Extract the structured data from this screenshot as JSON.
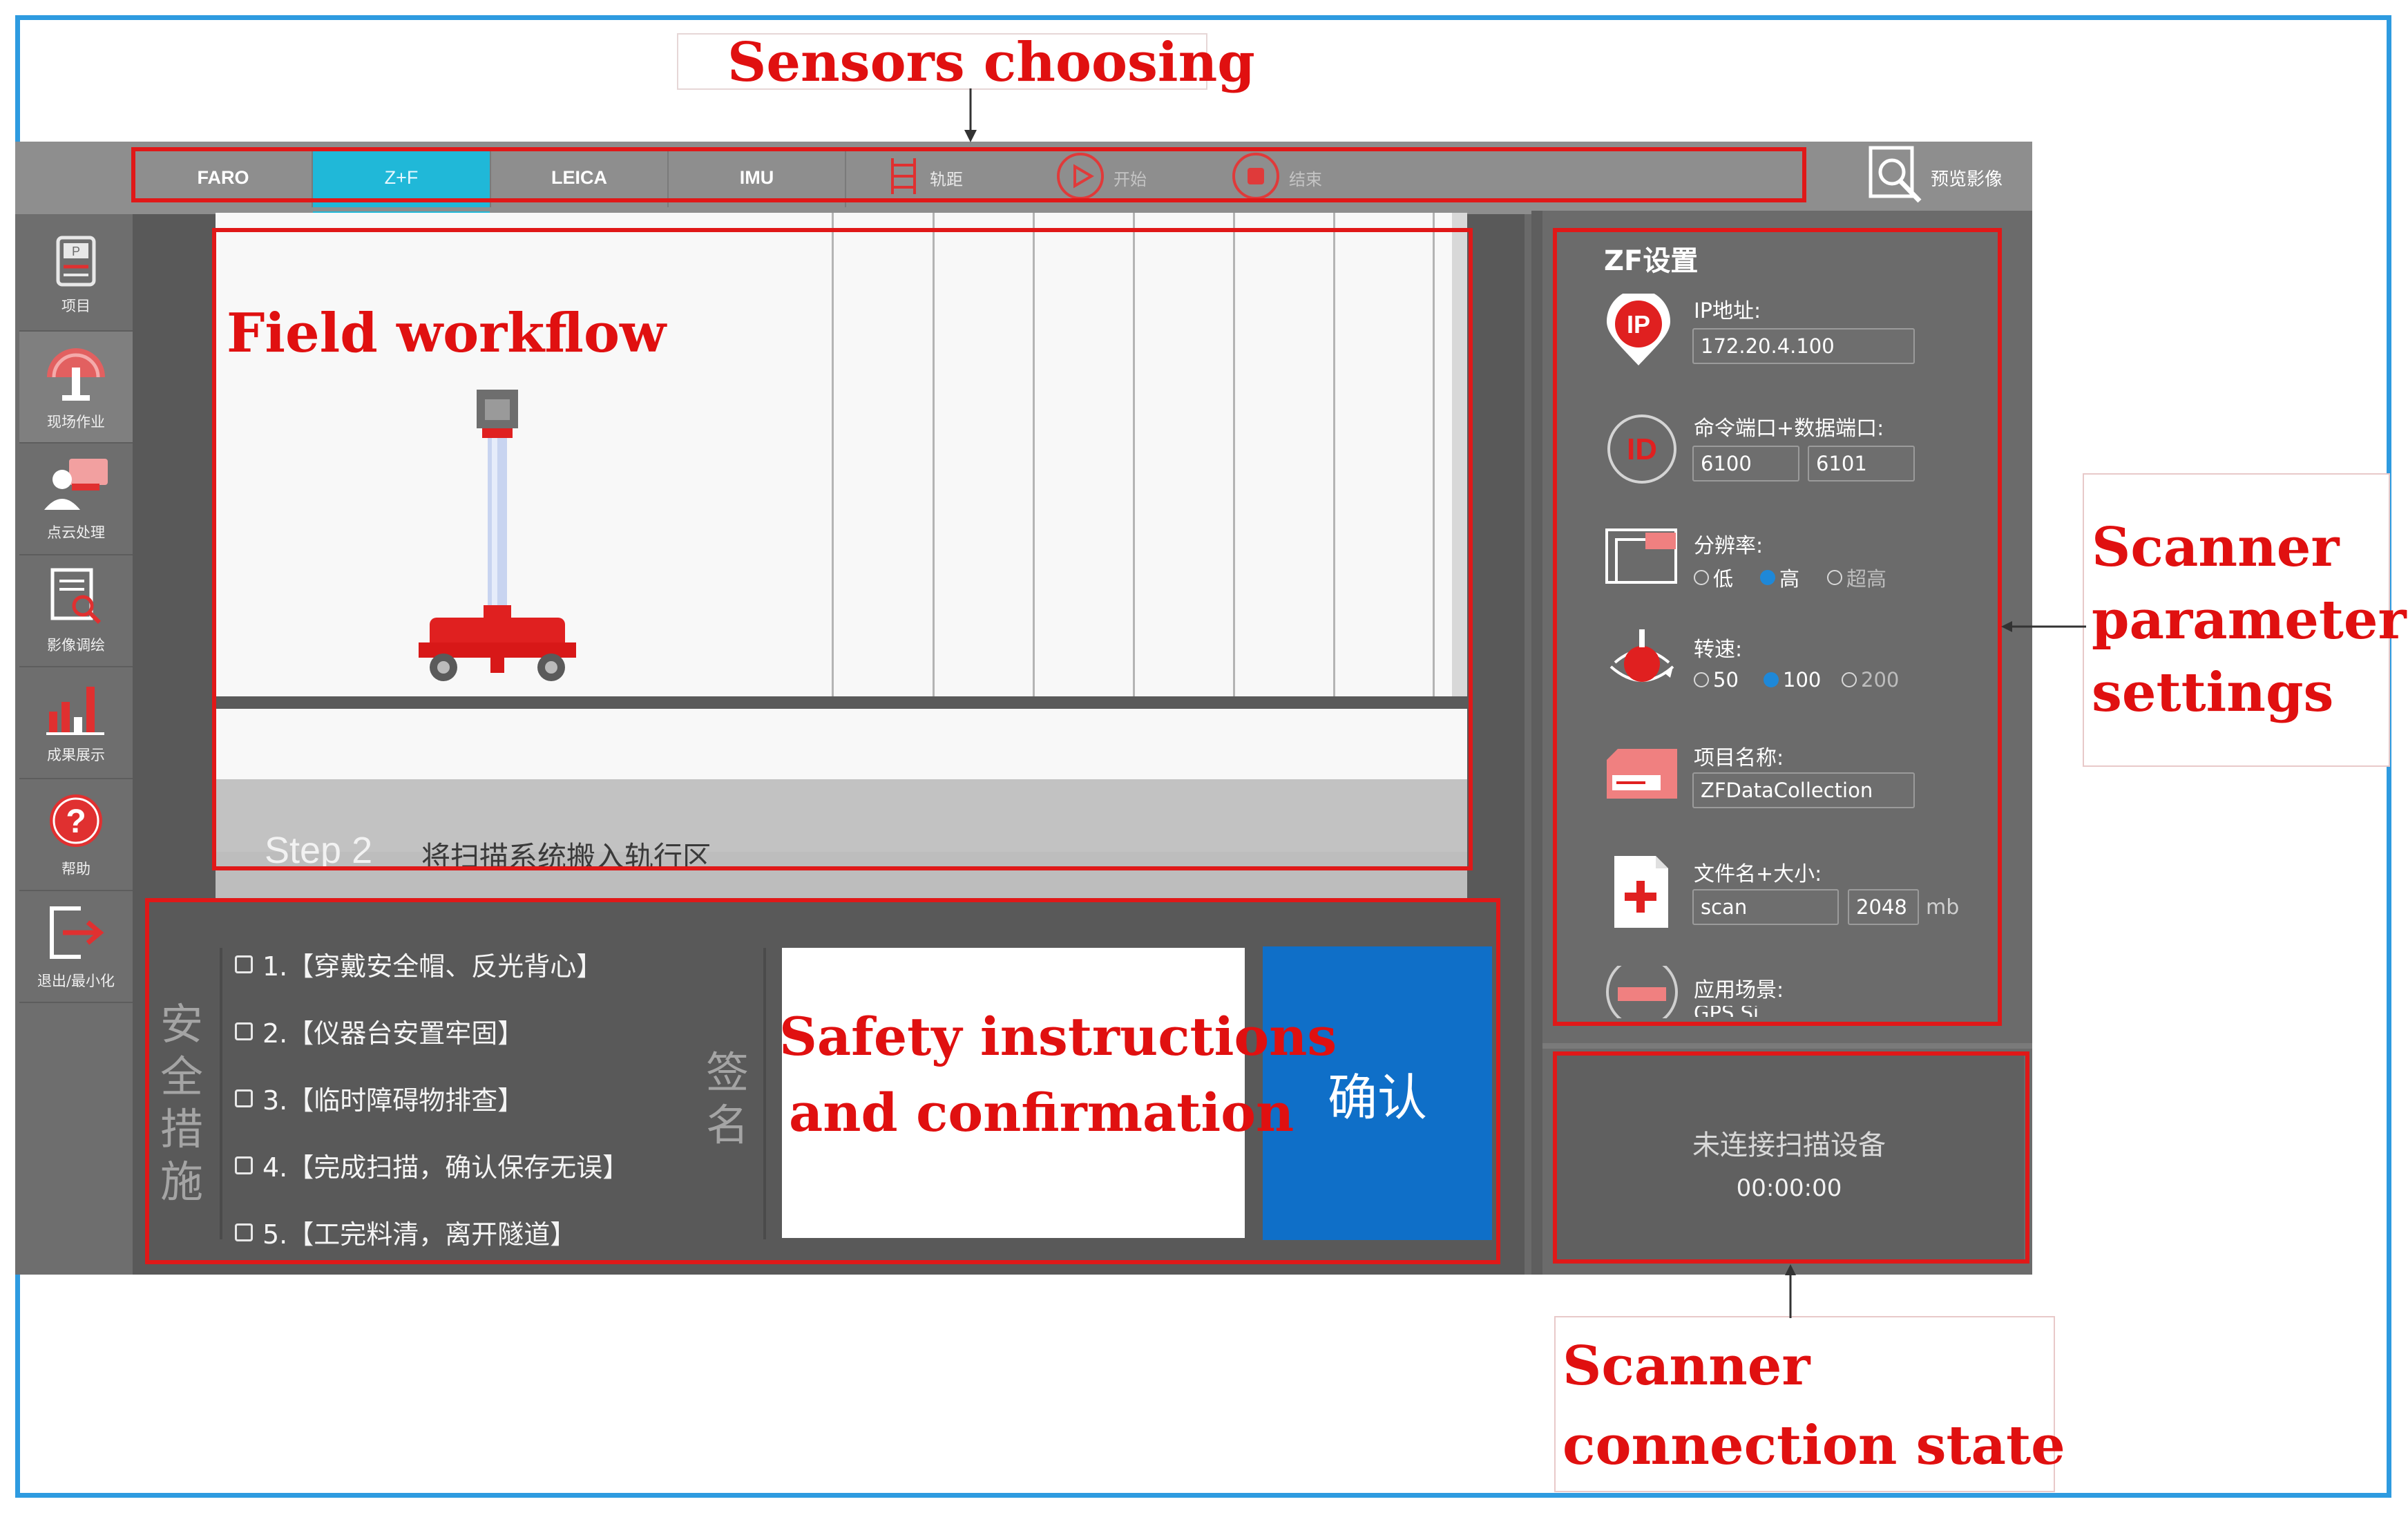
{
  "annotations": {
    "sensors_choosing": "Sensors choosing",
    "field_workflow": "Field workflow",
    "safety_line1": "Safety instructions",
    "safety_line2": "and confirmation",
    "scanner_param_line1": "Scanner",
    "scanner_param_line2": "parameter",
    "scanner_param_line3": "settings",
    "connection_line1": "Scanner",
    "connection_line2": "connection state"
  },
  "toolbar": {
    "tabs": [
      {
        "label": "FARO",
        "active": false
      },
      {
        "label": "Z+F",
        "active": true
      },
      {
        "label": "LEICA",
        "active": false
      },
      {
        "label": "IMU",
        "active": false
      }
    ],
    "gauge_label": "轨距",
    "start_label": "开始",
    "stop_label": "结束",
    "preview_label": "预览影像"
  },
  "sidebar": {
    "items": [
      {
        "label": "项目",
        "icon": "project-icon"
      },
      {
        "label": "现场作业",
        "icon": "field-work-icon",
        "active": true
      },
      {
        "label": "点云处理",
        "icon": "point-cloud-icon"
      },
      {
        "label": "影像调绘",
        "icon": "image-survey-icon"
      },
      {
        "label": "成果展示",
        "icon": "results-chart-icon"
      },
      {
        "label": "帮助",
        "icon": "help-icon"
      },
      {
        "label": "退出/最小化",
        "icon": "exit-icon"
      }
    ]
  },
  "workflow": {
    "step_number": "Step 2",
    "step_text": "将扫描系统搬入轨行区"
  },
  "safety": {
    "title": "安全措施",
    "items": [
      "1.【穿戴安全帽、反光背心】",
      "2.【仪器台安置牢固】",
      "3.【临时障碍物排查】",
      "4.【完成扫描，确认保存无误】",
      "5.【工完料清，离开隧道】"
    ],
    "sign_label": "签名",
    "confirm_label": "确认"
  },
  "settings": {
    "title": "ZF设置",
    "ip_label": "IP地址:",
    "ip_value": "172.20.4.100",
    "ip_badge": "IP",
    "id_badge": "ID",
    "port_label": "命令端口+数据端口:",
    "command_port": "6100",
    "data_port": "6101",
    "resolution_label": "分辨率:",
    "resolution_options": [
      "低",
      "高",
      "超高"
    ],
    "resolution_selected": "高",
    "speed_label": "转速:",
    "speed_options": [
      "50",
      "100",
      "200"
    ],
    "speed_selected": "100",
    "project_label": "项目名称:",
    "project_value": "ZFDataCollection",
    "file_label": "文件名+大小:",
    "file_name": "scan",
    "file_size": "2048",
    "file_unit": "mb",
    "scene_label": "应用场景:",
    "scene_option_partial": "GPS Si..."
  },
  "status": {
    "text": "未连接扫描设备",
    "clock": "00:00:00"
  },
  "colors": {
    "accent_tab": "#20b8d8",
    "confirm_button": "#0f6fc8",
    "annotation_red": "#e01818",
    "frame_blue": "#2e9be0"
  }
}
